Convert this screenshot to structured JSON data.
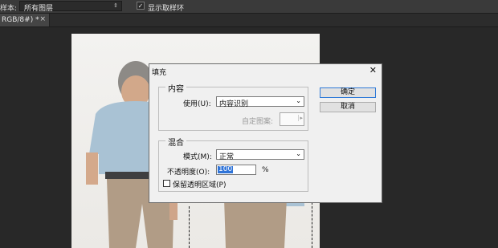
{
  "options_bar": {
    "sample_label": "样本:",
    "sample_value": "所有图层",
    "show_ring_checked": true,
    "show_ring_label": "显示取样环"
  },
  "document_tab": {
    "label": "RGB/8#) *",
    "close": "×"
  },
  "fill_dialog": {
    "title": "填充",
    "close": "✕",
    "contents": {
      "caption": "内容",
      "use_label": "使用(U):",
      "use_value": "内容识别",
      "custom_pattern_label": "自定图案:"
    },
    "blending": {
      "caption": "混合",
      "mode_label": "模式(M):",
      "mode_value": "正常",
      "opacity_label": "不透明度(O):",
      "opacity_value": "100",
      "opacity_unit": "%",
      "preserve_transparency_label": "保留透明区域(P)",
      "preserve_transparency_checked": false
    },
    "ok_label": "确定",
    "cancel_label": "取消"
  }
}
